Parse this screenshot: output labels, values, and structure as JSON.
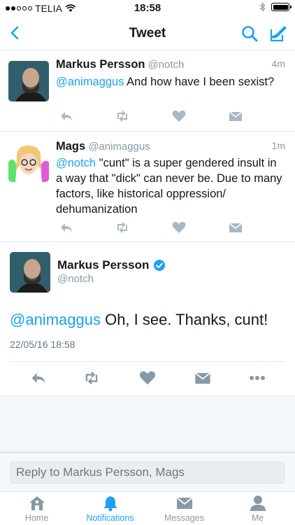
{
  "status_bar": {
    "carrier": "TELIA",
    "time": "18:58",
    "signal_bars_filled": 2,
    "signal_bars_total": 5,
    "battery_level": 1.0
  },
  "nav": {
    "title": "Tweet",
    "icons": [
      "back-chevron-icon",
      "search-icon",
      "compose-icon"
    ]
  },
  "colors": {
    "accent": "#1da1f2",
    "muted": "#8899a6",
    "action_icon": "#aab8c2",
    "verified": "#1da1f2"
  },
  "replies": [
    {
      "name": "Markus Persson",
      "handle": "@notch",
      "time": "4m",
      "mention": "@animaggus",
      "text": " And how have I been sexist?"
    },
    {
      "name": "Mags",
      "handle": "@animaggus",
      "time": "1m",
      "mention": "@notch",
      "text": " \"cunt\" is a super gendered insult in a way that \"dick\" can never be. Due to many factors, like historical oppression/ dehumanization"
    }
  ],
  "main_tweet": {
    "name": "Markus Persson",
    "handle": "@notch",
    "verified": true,
    "mention": "@animaggus",
    "text": " Oh, I see. Thanks, cunt!",
    "date": "22/05/16 18:58"
  },
  "reply_box": {
    "placeholder": "Reply to Markus Persson, Mags"
  },
  "tabs": [
    {
      "label": "Home",
      "icon": "home-icon",
      "active": false
    },
    {
      "label": "Notifications",
      "icon": "bell-icon",
      "active": true
    },
    {
      "label": "Messages",
      "icon": "envelope-icon",
      "active": false
    },
    {
      "label": "Me",
      "icon": "person-icon",
      "active": false
    }
  ]
}
